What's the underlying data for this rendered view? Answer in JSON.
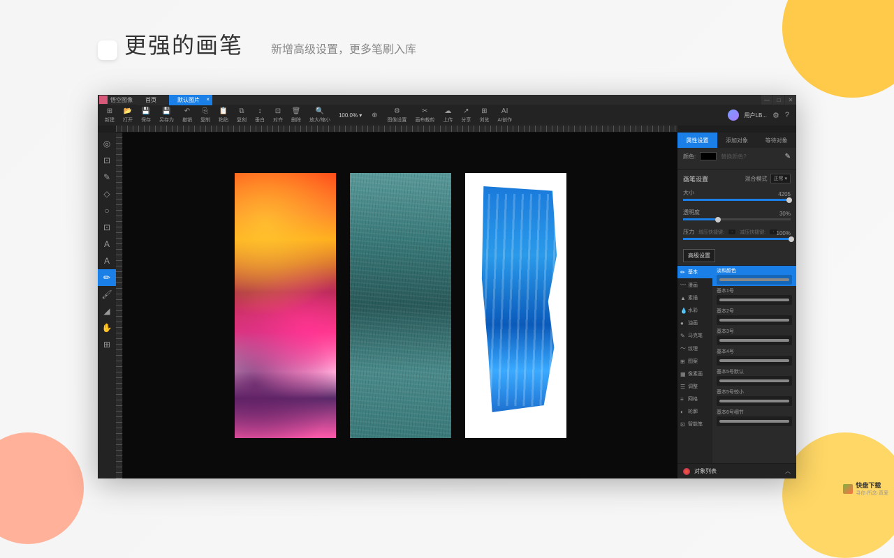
{
  "promo": {
    "title": "更强的画笔",
    "subtitle": "新增高级设置，更多笔刷入库"
  },
  "watermark": {
    "brand": "快盘下载",
    "tagline": "寻你·所念·真爱"
  },
  "app": {
    "name": "悟空图像",
    "home_tab": "首页",
    "canvas_tab": "默认图片",
    "close": "×",
    "user": "用户LB..."
  },
  "winbtns": {
    "min": "—",
    "max": "□",
    "close": "✕"
  },
  "toolbar": [
    {
      "icon": "⊞",
      "label": "新建"
    },
    {
      "icon": "📂",
      "label": "打开"
    },
    {
      "icon": "💾",
      "label": "保存"
    },
    {
      "icon": "💾",
      "label": "另存为"
    },
    {
      "icon": "↶",
      "label": "撤销"
    },
    {
      "icon": "⎘",
      "label": "复制"
    },
    {
      "icon": "📋",
      "label": "粘贴"
    },
    {
      "icon": "⧉",
      "label": "复刻"
    },
    {
      "icon": "↕",
      "label": "垂白"
    },
    {
      "icon": "⊡",
      "label": "对齐"
    },
    {
      "icon": "🗑",
      "label": "删除"
    },
    {
      "icon": "🔍",
      "label": "放大/缩小"
    },
    {
      "icon": "100.0%",
      "label": ""
    },
    {
      "icon": "⊕",
      "label": ""
    },
    {
      "icon": "⚙",
      "label": "图像设置"
    },
    {
      "icon": "✂",
      "label": "画布裁剪"
    },
    {
      "icon": "☁",
      "label": "上传"
    },
    {
      "icon": "↗",
      "label": "分享"
    },
    {
      "icon": "⊞",
      "label": "浏览"
    },
    {
      "icon": "AI",
      "label": "AI创作"
    }
  ],
  "zoom": "100.0% ▾",
  "left_tools": [
    {
      "icon": "◎",
      "name": "pointer"
    },
    {
      "icon": "⊡",
      "name": "select"
    },
    {
      "icon": "✎",
      "name": "pen"
    },
    {
      "icon": "◇",
      "name": "shape"
    },
    {
      "icon": "○",
      "name": "ellipse"
    },
    {
      "icon": "⊡",
      "name": "crop"
    },
    {
      "icon": "A",
      "name": "text"
    },
    {
      "icon": "A",
      "name": "text2"
    },
    {
      "icon": "✏",
      "name": "brush",
      "active": true
    },
    {
      "icon": "🖌",
      "name": "paint"
    },
    {
      "icon": "◢",
      "name": "gradient"
    },
    {
      "icon": "✋",
      "name": "hand"
    },
    {
      "icon": "⊞",
      "name": "grid"
    }
  ],
  "panel_tabs": {
    "props": "属性设置",
    "add": "添加对象",
    "wait": "等待对象"
  },
  "color": {
    "label": "颜色:",
    "replace": "替换颜色?"
  },
  "brush_section": {
    "title": "画笔设置",
    "blend_label": "混合模式",
    "blend_value": "正常 ▾"
  },
  "sliders": {
    "size": {
      "label": "大小",
      "value": "4205",
      "pct": 96
    },
    "opacity": {
      "label": "透明度",
      "value": "30%",
      "pct": 30
    },
    "pressure": {
      "label": "压力",
      "inc": "增压快捷键:",
      "dec": "减压快捷键:",
      "value": "100%",
      "pct": 100
    }
  },
  "advanced": "高级设置",
  "brush_cats": [
    {
      "icon": "✏",
      "label": "基本",
      "active": true
    },
    {
      "icon": "〰",
      "label": "漫画"
    },
    {
      "icon": "▲",
      "label": "素描"
    },
    {
      "icon": "💧",
      "label": "水彩"
    },
    {
      "icon": "●",
      "label": "油画"
    },
    {
      "icon": "✎",
      "label": "马克笔"
    },
    {
      "icon": "〜",
      "label": "纹理"
    },
    {
      "icon": "⊞",
      "label": "图案"
    },
    {
      "icon": "▦",
      "label": "像素画"
    },
    {
      "icon": "☰",
      "label": "调整"
    },
    {
      "icon": "≡",
      "label": "网格"
    },
    {
      "icon": "◐",
      "label": "轮廓"
    },
    {
      "icon": "⊡",
      "label": "智能笔"
    }
  ],
  "brushes": [
    {
      "name": "淡和颜色",
      "active": true
    },
    {
      "name": "基本1号"
    },
    {
      "name": "基本2号"
    },
    {
      "name": "基本3号"
    },
    {
      "name": "基本4号"
    },
    {
      "name": "基本5号默认"
    },
    {
      "name": "基本5号较小"
    },
    {
      "name": "基本6号细节"
    }
  ],
  "obj_list": {
    "title": "对象列表",
    "chev": "︿"
  }
}
